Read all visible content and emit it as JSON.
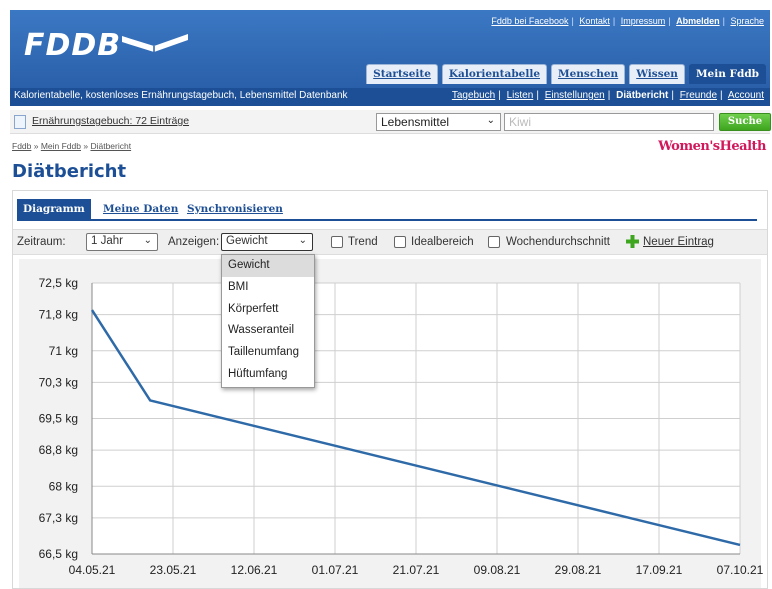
{
  "brand": {
    "logo": "FDDB"
  },
  "toplinks": [
    "Fddb bei Facebook",
    "Kontakt",
    "Impressum",
    "Abmelden",
    "Sprache"
  ],
  "nav_tabs": [
    "Startseite",
    "Kalorientabelle",
    "Menschen",
    "Wissen",
    "Mein Fddb"
  ],
  "subbar": {
    "tagline": "Kalorientabelle, kostenloses Ernährungstagebuch, Lebensmittel Datenbank",
    "links": [
      "Tagebuch",
      "Listen",
      "Einstellungen",
      "Diätbericht",
      "Freunde",
      "Account"
    ]
  },
  "search": {
    "diary_link": "Ernährungstagebuch: 72 Einträge",
    "category": "Lebensmittel",
    "placeholder": "Kiwi",
    "button": "Suche"
  },
  "breadcrumb": [
    "Fddb",
    "Mein Fddb",
    "Diätbericht"
  ],
  "sponsor": "Women'sHealth",
  "page_title": "Diätbericht",
  "tabs": [
    "Diagramm",
    "Meine Daten",
    "Synchronisieren"
  ],
  "controls": {
    "zeitraum_label": "Zeitraum:",
    "zeitraum_value": "1 Jahr",
    "anzeigen_label": "Anzeigen:",
    "anzeigen_value": "Gewicht",
    "trend": "Trend",
    "idealbereich": "Idealbereich",
    "wochendurchschnitt": "Wochendurchschnitt",
    "new_entry": "Neuer Eintrag"
  },
  "dropdown_options": [
    "Gewicht",
    "BMI",
    "Körperfett",
    "Wasseranteil",
    "Taillenumfang",
    "Hüftumfang"
  ],
  "colors": {
    "brand_blue": "#1c4f95",
    "line": "#2f6aa8",
    "search_green": "#3ea51f"
  },
  "chart_data": {
    "type": "line",
    "y_tick_labels": [
      "72,5 kg",
      "71,8 kg",
      "71 kg",
      "70,3 kg",
      "69,5 kg",
      "68,8 kg",
      "68 kg",
      "67,3 kg",
      "66,5 kg"
    ],
    "y_ticks": [
      72.5,
      71.8,
      71.0,
      70.3,
      69.5,
      68.8,
      68.0,
      67.3,
      66.5
    ],
    "x_tick_labels": [
      "04.05.21",
      "23.05.21",
      "12.06.21",
      "01.07.21",
      "21.07.21",
      "09.08.21",
      "29.08.21",
      "17.09.21",
      "07.10.21"
    ],
    "ylim": [
      66.5,
      72.5
    ],
    "grid": true,
    "series": [
      {
        "x": [
          "04.05.21",
          "18.05.21",
          "07.10.21"
        ],
        "y": [
          71.9,
          69.9,
          66.7
        ]
      }
    ]
  }
}
